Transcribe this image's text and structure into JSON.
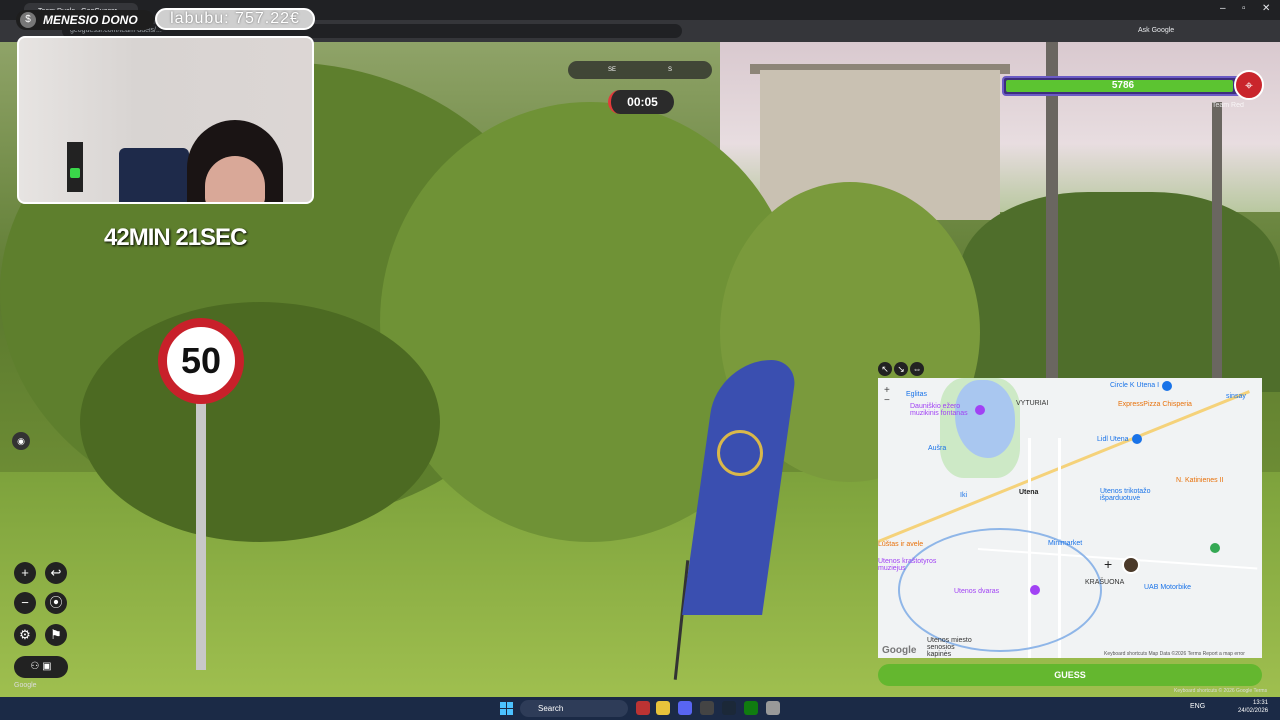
{
  "browser": {
    "tab_title": "Team Duels - GeoGuessr",
    "url": "geoguessr.com/team-duels/...",
    "ask_google": "Ask Google"
  },
  "stream": {
    "donor_name": "MENESIO DONO",
    "donation": "labubu: 757.22€",
    "elapsed": "42MIN 21SEC"
  },
  "game": {
    "compass": [
      "SE",
      "S"
    ],
    "round_timer": "00:05",
    "team_health": 5786,
    "team_health_fraction": 0.97,
    "team_label": "Team Red",
    "guess_label": "GUESS",
    "street_watermark": "Google",
    "keyboard_shortcuts": "Keyboard shortcuts  © 2026 Google  Terms"
  },
  "map": {
    "labels": [
      "Circle K Utena I",
      "Eglitas",
      "Dauniškio ežero muzikinis fontanas",
      "VYTURIAI",
      "ExpressPizza Chisperia",
      "sinsay",
      "Lidl Utena",
      "Aušra",
      "N. Katinienes II",
      "Iki",
      "Utena",
      "Utenos trikotažo išparduotuvė",
      "Lūštas ir avele",
      "Minimarket",
      "Utenos kraštotyros muziejus",
      "KRAŠUONA",
      "UAB Motorbike",
      "Utenos dvaras",
      "Utenos miesto senosios kapinės"
    ],
    "footer": "Keyboard shortcuts   Map Data ©2026   Terms   Report a map error",
    "brand": "Google"
  },
  "taskbar": {
    "search_label": "Search",
    "lang": "ENG",
    "time": "13:31",
    "date": "24/02/2026"
  },
  "colors": {
    "health_green": "#5cc431",
    "guess_green": "#64b72f",
    "team_red": "#c9252c",
    "sign_red": "#c8202a"
  }
}
